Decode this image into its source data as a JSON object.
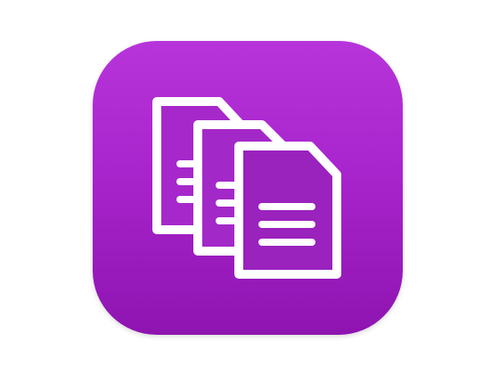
{
  "app_icon": {
    "icon_name": "documents-stack-icon",
    "background_top_color": "#b734da",
    "background_bottom_color": "#8e14b0",
    "glyph_color": "#ffffff",
    "document_count": 3
  }
}
